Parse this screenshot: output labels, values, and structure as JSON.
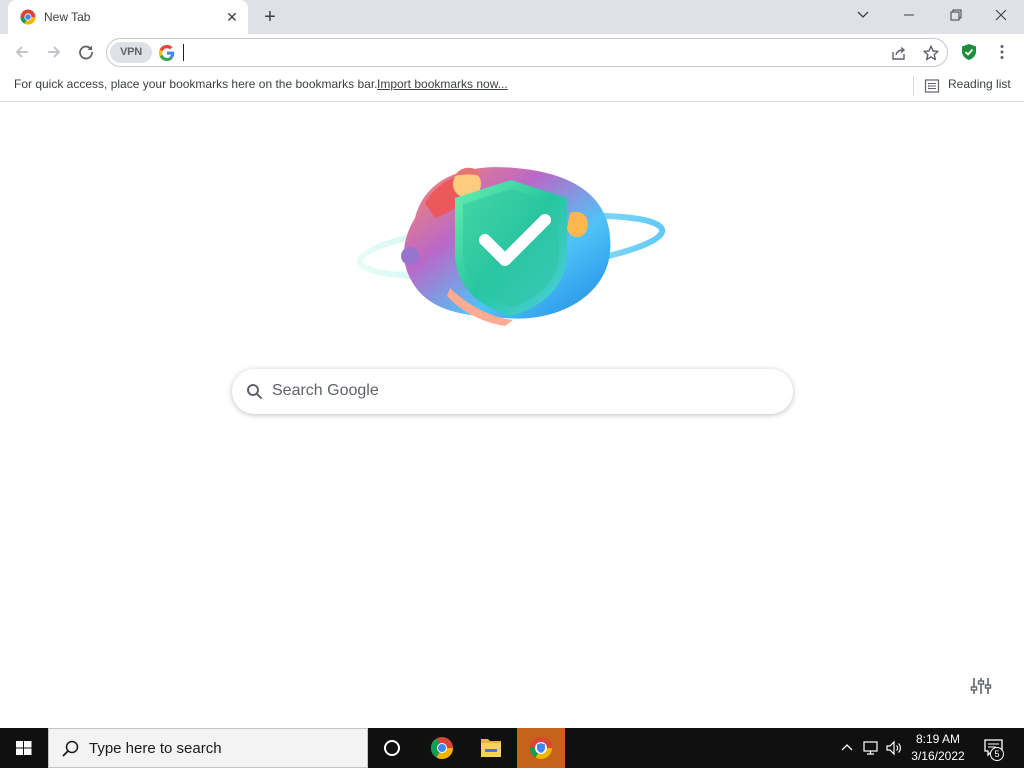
{
  "tab": {
    "title": "New Tab",
    "close_icon": "close-icon"
  },
  "toolbar": {
    "vpn_label": "VPN",
    "omnibox_value": "",
    "back_icon": "arrow-left-icon",
    "forward_icon": "arrow-right-icon",
    "reload_icon": "reload-icon"
  },
  "bookmarks_bar": {
    "prompt": "For quick access, place your bookmarks here on the bookmarks bar.",
    "import_link": "Import bookmarks now...",
    "reading_list": "Reading list"
  },
  "ntp": {
    "search_placeholder": "Search Google"
  },
  "taskbar": {
    "search_placeholder": "Type here to search",
    "time": "8:19 AM",
    "date": "3/16/2022",
    "notification_count": "5"
  },
  "colors": {
    "tabstrip": "#dee1e6",
    "taskbar": "#101010",
    "active_app": "#c7621d",
    "shield_green": "#1e8e3e"
  }
}
